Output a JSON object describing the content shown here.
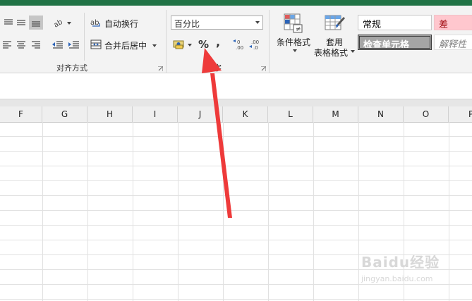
{
  "alignment": {
    "wrap_text_label": "自动换行",
    "merge_center_label": "合并后居中",
    "group_label": "对齐方式"
  },
  "number": {
    "format_value": "百分比",
    "percent_symbol": "%",
    "comma_symbol": ",",
    "group_label_partial": "字"
  },
  "styles_group": {
    "conditional_format_label": "条件格式",
    "table_format_label_line1": "套用",
    "table_format_label_line2": "表格格式",
    "style_normal": "常规",
    "style_bad": "差",
    "style_check_cell": "检查单元格",
    "style_explanatory": "解释性"
  },
  "columns": [
    "F",
    "G",
    "H",
    "I",
    "J",
    "K",
    "L",
    "M",
    "N",
    "O",
    "P"
  ],
  "watermark": {
    "brand": "Baidu经验",
    "url": "jingyan.baidu.com"
  },
  "colors": {
    "excel_green": "#217346",
    "bad_fill": "#ffc7ce",
    "bad_text": "#9c0006",
    "check_cell_fill": "#a5a5a5",
    "arrow_red": "#ee3a3a"
  }
}
